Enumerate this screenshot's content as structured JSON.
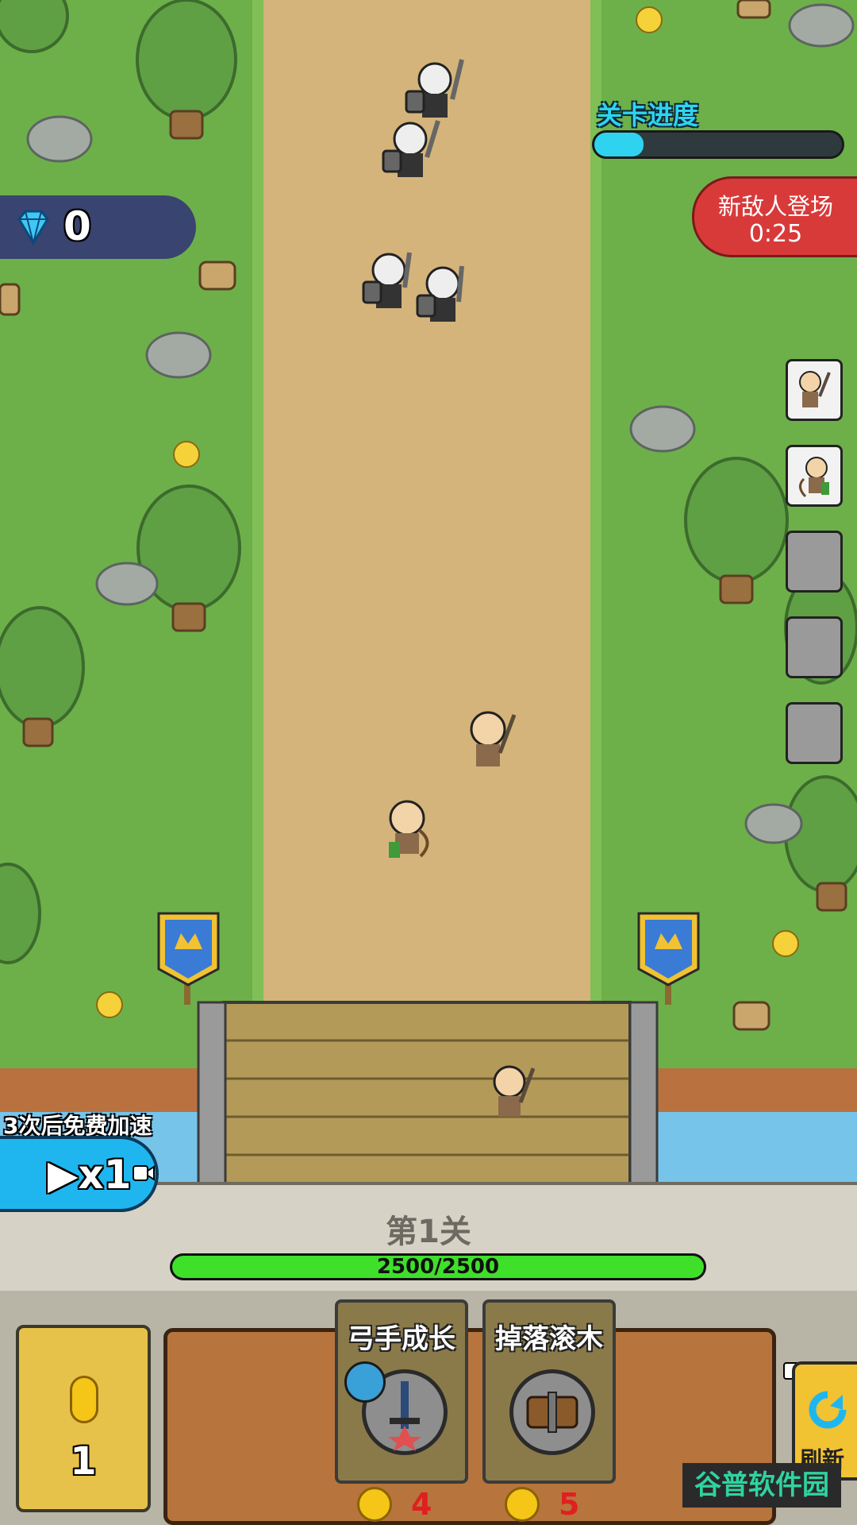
{
  "hud": {
    "gems": "0",
    "progress_label": "关卡进度",
    "progress_fraction": 0.2,
    "new_enemy_label": "新敌人登场",
    "new_enemy_timer": "0:25"
  },
  "speed": {
    "hint": "3次后免费加速",
    "label": "▶x1"
  },
  "castle": {
    "level_label": "第1关",
    "hp_text": "2500/2500",
    "hp_fraction": 1.0
  },
  "bottom": {
    "coins": "1",
    "cards": [
      {
        "title": "弓手成长",
        "cost": "4"
      },
      {
        "title": "掉落滚木",
        "cost": "5"
      }
    ],
    "refresh_label": "刷新"
  },
  "watermark": "谷普软件园",
  "colors": {
    "grass": "#6db04a",
    "path": "#d4b47a",
    "hp_green": "#3ee02a",
    "progress_cyan": "#2fd3f0",
    "alert_red": "#d83a3a",
    "speed_blue": "#1fb6f0"
  },
  "icons": {
    "gem": "diamond-icon",
    "speed": "play-icon",
    "video": "video-camera-icon",
    "refresh": "refresh-icon",
    "coin": "coin-icon"
  }
}
